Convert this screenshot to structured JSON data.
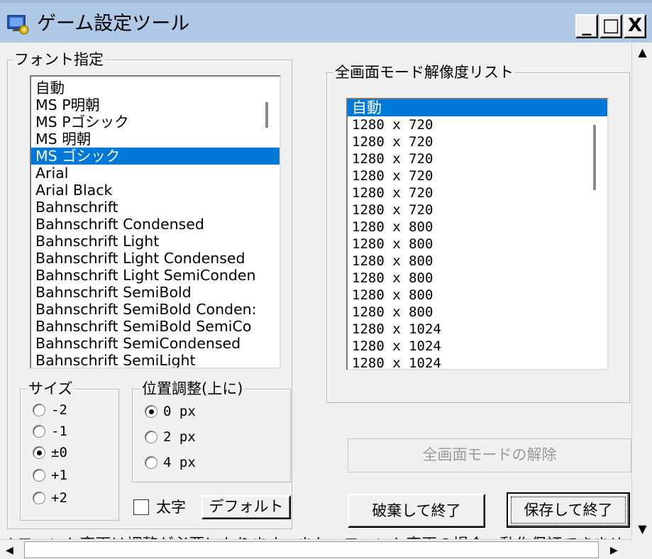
{
  "window": {
    "title": "ゲーム設定ツール",
    "minimize_label": "_",
    "maximize_label": "□",
    "close_label": "X"
  },
  "font_group": {
    "label": "フォント指定",
    "items": [
      "自動",
      "MS P明朝",
      "MS Pゴシック",
      "MS 明朝",
      "MS ゴシック",
      "Arial",
      "Arial Black",
      "Bahnschrift",
      "Bahnschrift Condensed",
      "Bahnschrift Light",
      "Bahnschrift Light Condensed",
      "Bahnschrift Light SemiConden",
      "Bahnschrift SemiBold",
      "Bahnschrift SemiBold Conden:",
      "Bahnschrift SemiBold SemiCo",
      "Bahnschrift SemiCondensed",
      "Bahnschrift SemiLight"
    ],
    "selected": "MS ゴシック"
  },
  "size_group": {
    "label": "サイズ",
    "options": [
      "-2",
      "-1",
      "±0",
      "+1",
      "+2"
    ],
    "selected": "±0"
  },
  "position_group": {
    "label": "位置調整(上に)",
    "options": [
      "0 px",
      "2 px",
      "4 px"
    ],
    "selected": "0 px"
  },
  "bold_checkbox": {
    "label": "太字",
    "checked": false
  },
  "default_button": {
    "label": "デフォルト"
  },
  "resolution_group": {
    "label": "全画面モード解像度リスト",
    "items": [
      "自動",
      "1280 x 720",
      "1280 x 720",
      "1280 x 720",
      "1280 x 720",
      "1280 x 720",
      "1280 x 720",
      "1280 x 800",
      "1280 x 800",
      "1280 x 800",
      "1280 x 800",
      "1280 x 800",
      "1280 x 800",
      "1280 x 1024",
      "1280 x 1024",
      "1280 x 1024"
    ],
    "selected": "自動"
  },
  "fullscreen_release_button": {
    "label": "全画面モードの解除",
    "enabled": false
  },
  "discard_exit_button": {
    "label": "破棄して終了"
  },
  "save_exit_button": {
    "label": "保存して終了"
  },
  "bottom_note": "※フォント変更は調整が必要になります。また、フォント変更の場合、動作保証できませ",
  "colors": {
    "title_bar": "#aec8e6",
    "selection": "#0078d7",
    "window_bg": "#f0f0f0"
  }
}
